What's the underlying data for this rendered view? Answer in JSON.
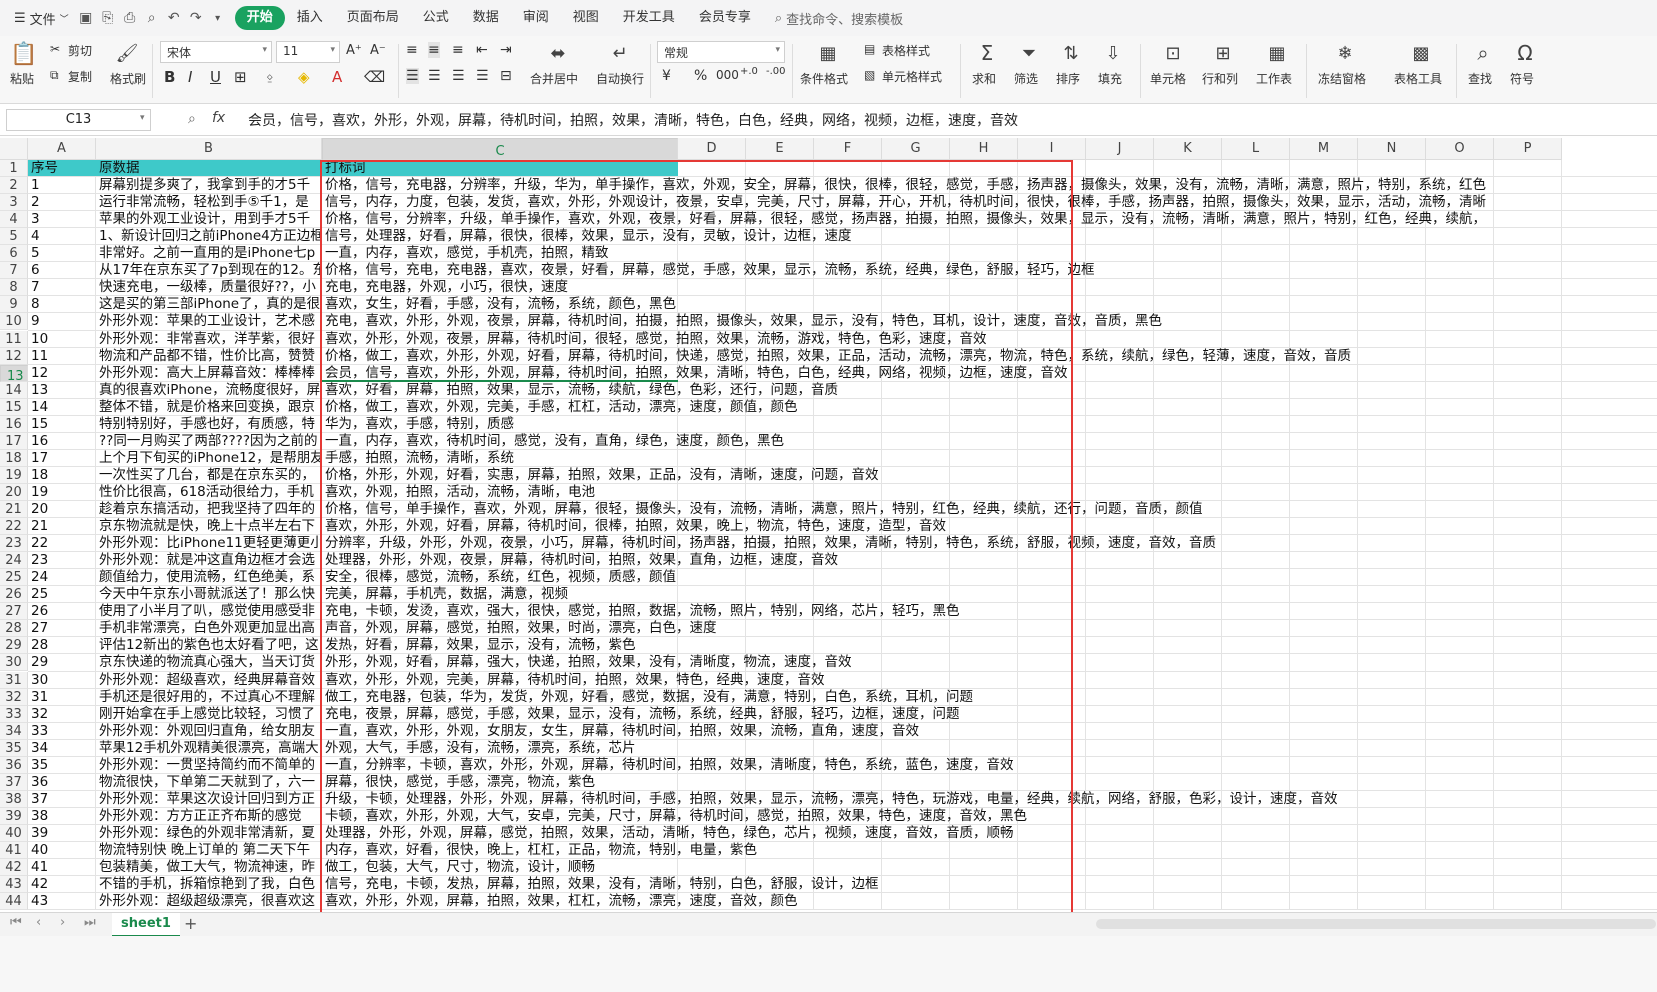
{
  "menubar": {
    "file": "文件",
    "tabs": [
      "开始",
      "插入",
      "页面布局",
      "公式",
      "数据",
      "审阅",
      "视图",
      "开发工具",
      "会员专享"
    ],
    "search": "查找命令、搜索模板"
  },
  "ribbon": {
    "paste": "粘贴",
    "cut": "剪切",
    "copy": "复制",
    "format_painter": "格式刷",
    "font": "宋体",
    "size": "11",
    "merge": "合并居中",
    "wrap": "自动换行",
    "numfmt": "常规",
    "cond": "条件格式",
    "table_style": "表格样式",
    "cell_style": "单元格样式",
    "sum": "求和",
    "filter": "筛选",
    "sort": "排序",
    "fill": "填充",
    "cell": "单元格",
    "rowcol": "行和列",
    "sheet": "工作表",
    "freeze": "冻结窗格",
    "tools": "表格工具",
    "find": "查找",
    "symbol": "符号"
  },
  "formula": {
    "namebox": "C13",
    "fx": "fx",
    "content": "会员，信号，喜欢，外形，外观，屏幕，待机时间，拍照，效果，清晰，特色，白色，经典，网络，视频，边框，速度，音效"
  },
  "columns": [
    "A",
    "B",
    "C",
    "D",
    "E",
    "F",
    "G",
    "H",
    "I",
    "J",
    "K",
    "L",
    "M",
    "N",
    "O",
    "P"
  ],
  "header": {
    "a": "序号",
    "b": "原数据",
    "c": "打标词"
  },
  "rows": [
    {
      "a": "1",
      "b": "屏幕别提多爽了，我拿到手的才5千",
      "c": "价格，信号，充电器，分辨率，升级，华为，单手操作，喜欢，外观，安全，屏幕，很快，很棒，很轻，感觉，手感，扬声器，摄像头，效果，没有，流畅，清晰，满意，照片，特别，系统，红色"
    },
    {
      "a": "2",
      "b": "运行非常流畅，轻松到手⑤千1，是",
      "c": "信号，内存，力度，包装，发货，喜欢，外形，外观设计，夜景，安卓，完美，尺寸，屏幕，开心，开机，待机时间，很快，很棒，手感，扬声器，拍照，摄像头，效果，显示，活动，流畅，清晰"
    },
    {
      "a": "3",
      "b": "苹果的外观工业设计，用到手才5千",
      "c": "价格，信号，分辨率，升级，单手操作，喜欢，外观，夜景，好看，屏幕，很轻，感觉，扬声器，拍摄，拍照，摄像头，效果，显示，没有，流畅，清晰，满意，照片，特别，红色，经典，续航，"
    },
    {
      "a": "4",
      "b": "1、新设计回归之前iPhone4方正边框",
      "c": "信号，处理器，好看，屏幕，很快，很棒，效果，显示，没有，灵敏，设计，边框，速度"
    },
    {
      "a": "5",
      "b": "非常好。之前一直用的是iPhone七p",
      "c": "一直，内存，喜欢，感觉，手机壳，拍照，精致"
    },
    {
      "a": "6",
      "b": "从17年在京东买了7p到现在的12。东",
      "c": "价格，信号，充电，充电器，喜欢，夜景，好看，屏幕，感觉，手感，效果，显示，流畅，系统，经典，绿色，舒服，轻巧，边框"
    },
    {
      "a": "7",
      "b": "快速充电，一级棒，质量很好??，小",
      "c": "充电，充电器，外观，小巧，很快，速度"
    },
    {
      "a": "8",
      "b": "这是买的第三部iPhone了，真的是很",
      "c": "喜欢，女生，好看，手感，没有，流畅，系统，颜色，黑色"
    },
    {
      "a": "9",
      "b": "外形外观：苹果的工业设计，艺术感",
      "c": "充电，喜欢，外形，外观，夜景，屏幕，待机时间，拍摄，拍照，摄像头，效果，显示，没有，特色，耳机，设计，速度，音效，音质，黑色"
    },
    {
      "a": "10",
      "b": "外形外观：非常喜欢，洋芋紫，很好",
      "c": "喜欢，外形，外观，夜景，屏幕，待机时间，很轻，感觉，拍照，效果，流畅，游戏，特色，色彩，速度，音效"
    },
    {
      "a": "11",
      "b": "物流和产品都不错，性价比高，赞赞",
      "c": "价格，做工，喜欢，外形，外观，好看，屏幕，待机时间，快递，感觉，拍照，效果，正品，活动，流畅，漂亮，物流，特色，系统，续航，绿色，轻薄，速度，音效，音质"
    },
    {
      "a": "12",
      "b": "外形外观：高大上屏幕音效：棒棒棒",
      "c": "会员，信号，喜欢，外形，外观，屏幕，待机时间，拍照，效果，清晰，特色，白色，经典，网络，视频，边框，速度，音效"
    },
    {
      "a": "13",
      "b": "真的很喜欢iPhone，流畅度很好，屏",
      "c": "喜欢，好看，屏幕，拍照，效果，显示，流畅，续航，绿色，色彩，还行，问题，音质"
    },
    {
      "a": "14",
      "b": "整体不错，就是价格来回变换，跟京",
      "c": "价格，做工，喜欢，外观，完美，手感，杠杠，活动，漂亮，速度，颜值，颜色"
    },
    {
      "a": "15",
      "b": "特别特别好，手感也好，有质感，特",
      "c": "华为，喜欢，手感，特别，质感"
    },
    {
      "a": "16",
      "b": "??同一月购买了两部????因为之前的",
      "c": "一直，内存，喜欢，待机时间，感觉，没有，直角，绿色，速度，颜色，黑色"
    },
    {
      "a": "17",
      "b": "上个月下旬买的iPhone12，是帮朋友",
      "c": "手感，拍照，流畅，清晰，系统"
    },
    {
      "a": "18",
      "b": "一次性买了几台，都是在京东买的，",
      "c": "价格，外形，外观，好看，实惠，屏幕，拍照，效果，正品，没有，清晰，速度，问题，音效"
    },
    {
      "a": "19",
      "b": "性价比很高，618活动很给力，手机",
      "c": "喜欢，外观，拍照，活动，流畅，清晰，电池"
    },
    {
      "a": "20",
      "b": "趁着京东搞活动，把我坚持了四年的",
      "c": "价格，信号，单手操作，喜欢，外观，屏幕，很轻，摄像头，没有，流畅，清晰，满意，照片，特别，红色，经典，续航，还行，问题，音质，颜值"
    },
    {
      "a": "21",
      "b": "京东物流就是快，晚上十点半左右下",
      "c": "喜欢，外形，外观，好看，屏幕，待机时间，很棒，拍照，效果，晚上，物流，特色，速度，造型，音效"
    },
    {
      "a": "22",
      "b": "外形外观：比iPhone11更轻更薄更小",
      "c": "分辨率，升级，外形，外观，夜景，小巧，屏幕，待机时间，扬声器，拍摄，拍照，效果，清晰，特别，特色，系统，舒服，视频，速度，音效，音质"
    },
    {
      "a": "23",
      "b": "外形外观：就是冲这直角边框才会选",
      "c": "处理器，外形，外观，夜景，屏幕，待机时间，拍照，效果，直角，边框，速度，音效"
    },
    {
      "a": "24",
      "b": "颜值给力，使用流畅，红色绝美，系",
      "c": "安全，很棒，感觉，流畅，系统，红色，视频，质感，颜值"
    },
    {
      "a": "25",
      "b": "今天中午京东小哥就派送了！那么快",
      "c": "完美，屏幕，手机壳，数据，满意，视频"
    },
    {
      "a": "26",
      "b": "使用了小半月了叭，感觉使用感受非",
      "c": "充电，卡顿，发烫，喜欢，强大，很快，感觉，拍照，数据，流畅，照片，特别，网络，芯片，轻巧，黑色"
    },
    {
      "a": "27",
      "b": "手机非常漂亮，白色外观更加显出高",
      "c": "声音，外观，屏幕，感觉，拍照，效果，时尚，漂亮，白色，速度"
    },
    {
      "a": "28",
      "b": "评估12新出的紫色也太好看了吧，这",
      "c": "发热，好看，屏幕，效果，显示，没有，流畅，紫色"
    },
    {
      "a": "29",
      "b": "京东快递的物流真心强大，当天订货",
      "c": "外形，外观，好看，屏幕，强大，快递，拍照，效果，没有，清晰度，物流，速度，音效"
    },
    {
      "a": "30",
      "b": "外形外观：超级喜欢，经典屏幕音效",
      "c": "喜欢，外形，外观，完美，屏幕，待机时间，拍照，效果，特色，经典，速度，音效"
    },
    {
      "a": "31",
      "b": "手机还是很好用的，不过真心不理解",
      "c": "做工，充电器，包装，华为，发货，外观，好看，感觉，数据，没有，满意，特别，白色，系统，耳机，问题"
    },
    {
      "a": "32",
      "b": "刚开始拿在手上感觉比较轻，习惯了",
      "c": "充电，夜景，屏幕，感觉，手感，效果，显示，没有，流畅，系统，经典，舒服，轻巧，边框，速度，问题"
    },
    {
      "a": "33",
      "b": "外形外观：外观回归直角，给女朋友",
      "c": "一直，喜欢，外形，外观，女朋友，女生，屏幕，待机时间，拍照，效果，流畅，直角，速度，音效"
    },
    {
      "a": "34",
      "b": "苹果12手机外观精美很漂亮，高端大",
      "c": "外观，大气，手感，没有，流畅，漂亮，系统，芯片"
    },
    {
      "a": "35",
      "b": "外形外观：一贯坚持简约而不简单的",
      "c": "一直，分辨率，卡顿，喜欢，外形，外观，屏幕，待机时间，拍照，效果，清晰度，特色，系统，蓝色，速度，音效"
    },
    {
      "a": "36",
      "b": "物流很快，下单第二天就到了，六一",
      "c": "屏幕，很快，感觉，手感，漂亮，物流，紫色"
    },
    {
      "a": "37",
      "b": "外形外观：苹果这次设计回归到方正",
      "c": "升级，卡顿，处理器，外形，外观，屏幕，待机时间，手感，拍照，效果，显示，流畅，漂亮，特色，玩游戏，电量，经典，续航，网络，舒服，色彩，设计，速度，音效"
    },
    {
      "a": "38",
      "b": "外形外观：方方正正齐布斯的感觉",
      "c": "卡顿，喜欢，外形，外观，大气，安卓，完美，尺寸，屏幕，待机时间，感觉，拍照，效果，特色，速度，音效，黑色"
    },
    {
      "a": "39",
      "b": "外形外观：绿色的外观非常清新，夏",
      "c": "处理器，外形，外观，屏幕，感觉，拍照，效果，活动，清晰，特色，绿色，芯片，视频，速度，音效，音质，顺畅"
    },
    {
      "a": "40",
      "b": "物流特别快 晚上订单的 第二天下午",
      "c": "内存，喜欢，好看，很快，晚上，杠杠，正品，物流，特别，电量，紫色"
    },
    {
      "a": "41",
      "b": "包装精美，做工大气，物流神速，昨",
      "c": "做工，包装，大气，尺寸，物流，设计，顺畅"
    },
    {
      "a": "42",
      "b": "不错的手机，拆箱惊艳到了我，白色",
      "c": "信号，充电，卡顿，发热，屏幕，拍照，效果，没有，清晰，特别，白色，舒服，设计，边框"
    },
    {
      "a": "43",
      "b": "外形外观：超级超级漂亮，很喜欢这",
      "c": "喜欢，外形，外观，屏幕，拍照，效果，杠杠，流畅，漂亮，速度，音效，颜色"
    }
  ],
  "sheet": {
    "tab": "sheet1",
    "add": "+"
  }
}
